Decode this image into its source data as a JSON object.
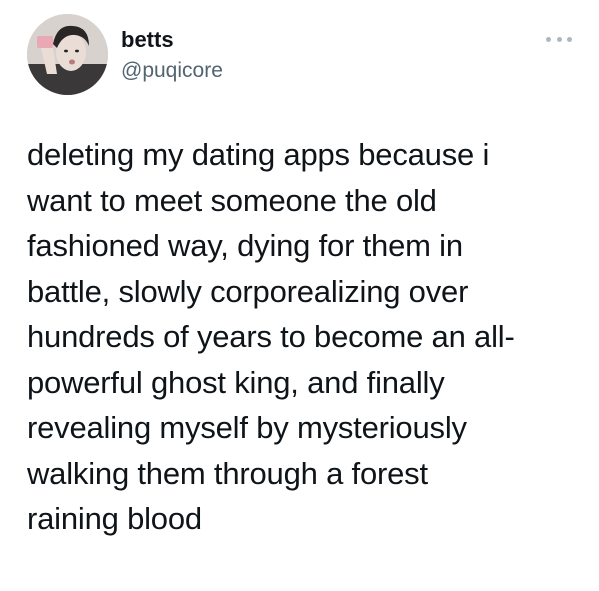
{
  "author": {
    "display_name": "betts",
    "handle": "@puqicore",
    "avatar_icon": "profile-photo"
  },
  "menu": {
    "icon": "more-horizontal-icon"
  },
  "tweet": {
    "lines": [
      "deleting my dating apps because i",
      "want to meet someone the old",
      "fashioned way, dying for them in",
      "battle, slowly corporealizing over",
      "hundreds of years to become an all-",
      "powerful ghost king, and finally",
      "revealing myself by mysteriously",
      "walking them through a forest",
      "raining blood"
    ]
  },
  "colors": {
    "text": "#0f1419",
    "handle": "#536471",
    "menu_dots": "#aab8c2",
    "background": "#ffffff"
  }
}
